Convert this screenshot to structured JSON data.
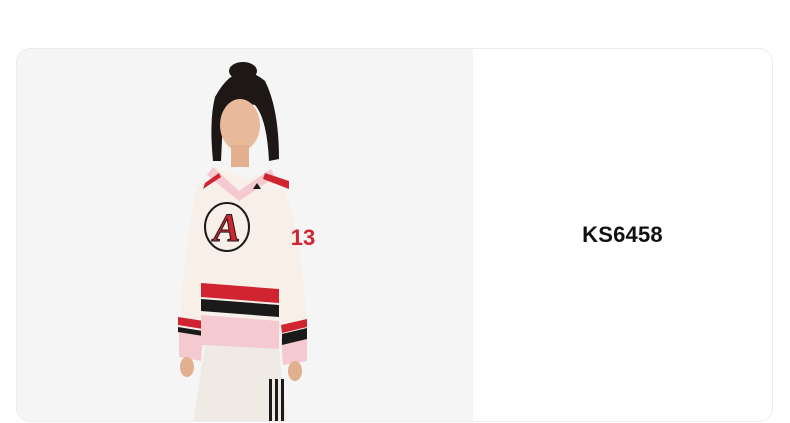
{
  "product": {
    "sku": "KS6458",
    "image": {
      "jersey_number": "13",
      "crest_letter": "A"
    }
  },
  "colors": {
    "image_bg": "#f5f5f5",
    "jersey_cream": "#f7efe8",
    "jersey_pink": "#f4c9cf",
    "stripe_red": "#d02431",
    "stripe_black": "#1a1a1a",
    "text": "#111111"
  }
}
